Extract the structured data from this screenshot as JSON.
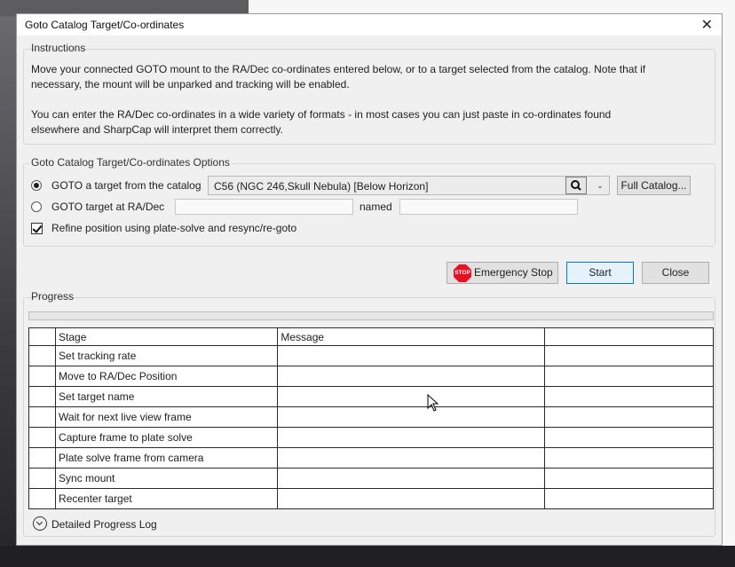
{
  "window": {
    "title": "Goto Catalog Target/Co-ordinates",
    "close_glyph": "✕"
  },
  "instructions": {
    "label": "Instructions",
    "line1": "Move your connected GOTO mount to the RA/Dec co-ordinates entered below, or to a target selected from the catalog. Note that if",
    "line2": "necessary, the mount will be unparked and tracking will be enabled.",
    "line3": "You can enter the RA/Dec co-ordinates in a wide variety of formats - in most cases you can just paste in co-ordinates found",
    "line4": "elsewhere and SharpCap will interpret them correctly."
  },
  "options": {
    "label": "Goto Catalog Target/Co-ordinates Options",
    "radio_catalog": {
      "label": "GOTO a target from the catalog",
      "selected": true
    },
    "catalog_combo": {
      "value": "C56 (NGC 246,Skull Nebula) [Below Horizon]",
      "search_icon": "search-icon",
      "arrow": "⌄"
    },
    "full_catalog_button": "Full Catalog...",
    "radio_radec": {
      "label": "GOTO target at RA/Dec",
      "selected": false,
      "value": ""
    },
    "named_label": "named",
    "named_value": "",
    "refine_checkbox": {
      "label": "Refine position using plate-solve and resync/re-goto",
      "checked": true
    }
  },
  "actions": {
    "emergency_stop": "Emergency Stop",
    "stop_badge": "STOP",
    "start": "Start",
    "close": "Close"
  },
  "progress": {
    "label": "Progress",
    "fraction": 0,
    "columns": [
      "Stage",
      "Message",
      ""
    ],
    "rows": [
      {
        "stage": "Set tracking rate",
        "message": "",
        "extra": ""
      },
      {
        "stage": "Move to RA/Dec Position",
        "message": "",
        "extra": ""
      },
      {
        "stage": "Set target name",
        "message": "",
        "extra": ""
      },
      {
        "stage": "Wait for next live view frame",
        "message": "",
        "extra": ""
      },
      {
        "stage": "Capture frame to plate solve",
        "message": "",
        "extra": ""
      },
      {
        "stage": "Plate solve frame from camera",
        "message": "",
        "extra": ""
      },
      {
        "stage": "Sync mount",
        "message": "",
        "extra": ""
      },
      {
        "stage": "Recenter target",
        "message": "",
        "extra": ""
      }
    ],
    "log_label": "Detailed Progress Log"
  },
  "colors": {
    "accent": "#0078d7",
    "stop": "#e81123",
    "progress_fill": "#06b025"
  }
}
